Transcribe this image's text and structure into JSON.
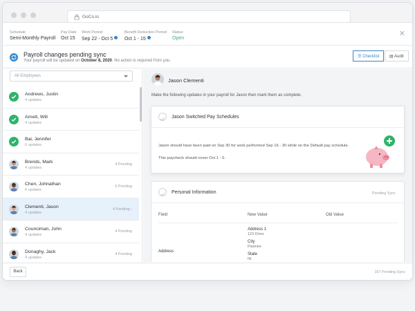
{
  "browser": {
    "url": "GoCo.io"
  },
  "header": {
    "schedule": {
      "label": "Schedule",
      "value": "Semi-Monthly Payroll"
    },
    "pay_date": {
      "label": "Pay Date",
      "value": "Oct 15"
    },
    "work_period": {
      "label": "Work Period",
      "value": "Sep 22 - Oct 5"
    },
    "benefit_period": {
      "label": "Benefit Deduction Period",
      "value": "Oct 1 - 15"
    },
    "status": {
      "label": "Status",
      "value": "Open"
    }
  },
  "subheader": {
    "title": "Payroll changes pending sync",
    "desc_prefix": "Your payroll will be updated on ",
    "desc_date": "October 8, 2020",
    "desc_suffix": ". No action is required from you.",
    "checklist_label": "Checklist",
    "audit_label": "Audit"
  },
  "filter": {
    "placeholder": "All Employees"
  },
  "employees": [
    {
      "name": "Andrews, Justin",
      "updates": "4 updates",
      "pending": "",
      "state": "done"
    },
    {
      "name": "Arnett, Will",
      "updates": "4 updates",
      "pending": "",
      "state": "done"
    },
    {
      "name": "Bai, Jennifer",
      "updates": "6 updates",
      "pending": "",
      "state": "done"
    },
    {
      "name": "Brends, Mark",
      "updates": "4 updates",
      "pending": "4 Pending",
      "state": "pending"
    },
    {
      "name": "Chen, Johnathan",
      "updates": "6 updates",
      "pending": "6 Pending",
      "state": "pending"
    },
    {
      "name": "Clementi, Jason",
      "updates": "4 updates",
      "pending": "4 Pending",
      "state": "selected"
    },
    {
      "name": "Counciman, John",
      "updates": "4 updates",
      "pending": "4 Pending",
      "state": "pending"
    },
    {
      "name": "Donaghy, Jack",
      "updates": "4 updates",
      "pending": "4 Pending",
      "state": "pending"
    }
  ],
  "detail": {
    "employee_name": "Jason Clementi",
    "instruction": "Make the following updates in your payroll for Jason then mark them as complete.",
    "card1": {
      "title": "Jason Switched Pay Schedules",
      "line1": "Jason should have been paid on Sep 30 for work performed Sep 16 - 30 while on the Default pay schedule.",
      "line2": "This paycheck should cover Oct 1 - 5."
    },
    "card2": {
      "title": "Personal Information",
      "status": "Pending Sync",
      "col_field": "Field",
      "col_new": "New Value",
      "col_old": "Old Value",
      "field": "Address",
      "values": [
        {
          "label": "Address 1",
          "value": "123 Drive"
        },
        {
          "label": "City",
          "value": "Pawnee"
        },
        {
          "label": "State",
          "value": "IN"
        }
      ]
    }
  },
  "footer": {
    "back_label": "Back",
    "pending_count": "167 Pending Sync"
  },
  "colors": {
    "accent": "#3b82c4",
    "success": "#2fb36b",
    "selected_row": "#e7f1fb"
  }
}
